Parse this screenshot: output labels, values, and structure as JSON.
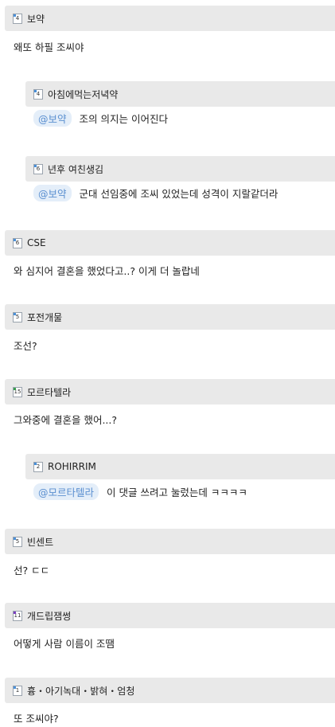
{
  "comments": [
    {
      "nick": "보약",
      "level": "4",
      "text": "왜또 하필 조씨야"
    },
    {
      "nick": "아침에먹는저녁약",
      "level": "4",
      "mention": "@보약",
      "text": "조의 의지는 이어진다"
    },
    {
      "nick": "년후 여친생김",
      "level": "6",
      "mention": "@보약",
      "text": "군대 선임중에 조씨 있었는데 성격이 지랄같더라"
    },
    {
      "nick": "CSE",
      "level": "6",
      "text": "와 심지어 결혼을 했었다고..? 이게 더 놀랍네"
    },
    {
      "nick": "포전개물",
      "level": "5",
      "text": "조선?"
    },
    {
      "nick": "모르타텔라",
      "level": "15",
      "text": "그와중에 결혼을 했어...?"
    },
    {
      "nick": "ROHIRRIM",
      "level": "2",
      "mention": "@모르타텔라",
      "text": "이 댓글 쓰려고 눌렀는데 ㅋㅋㅋㅋ"
    },
    {
      "nick": "빈센트",
      "level": "5",
      "text": "선? ㄷㄷ"
    },
    {
      "nick": "개드립잼썽",
      "level": "11",
      "text": "어떻게 사람 이름이 조땜"
    },
    {
      "nick": "흉・아기녹대・밝혀・엄청",
      "level": "1",
      "text": "또 조씨야?"
    }
  ]
}
